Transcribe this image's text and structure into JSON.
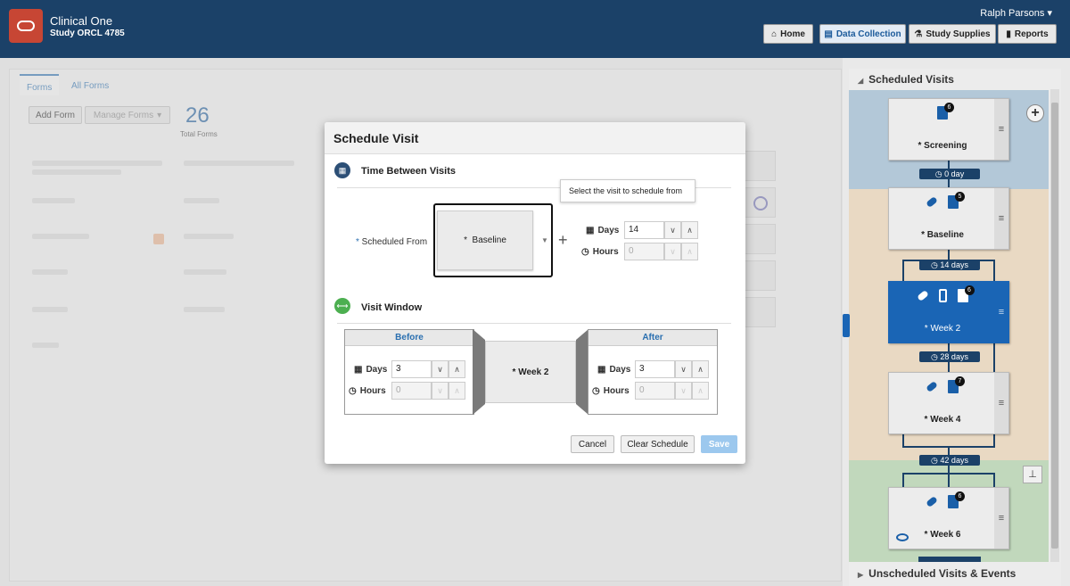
{
  "header": {
    "app_title": "Clinical One",
    "study": "Study ORCL 4785",
    "user": "Ralph Parsons",
    "nav": [
      {
        "label": "Home",
        "icon": "home-icon"
      },
      {
        "label": "Data Collection",
        "icon": "document-icon"
      },
      {
        "label": "Study Supplies",
        "icon": "supplies-icon"
      },
      {
        "label": "Reports",
        "icon": "bar-chart-icon"
      }
    ]
  },
  "forms": {
    "tabs": [
      "Forms",
      "All Forms"
    ],
    "add_form": "Add Form",
    "manage_forms": "Manage Forms",
    "total": "26",
    "total_label": "Total Forms"
  },
  "modal": {
    "title": "Schedule Visit",
    "section1": "Time Between Visits",
    "tooltip": "Select the visit to schedule from",
    "scheduled_from_label": "Scheduled From",
    "scheduled_from_value": "Baseline",
    "days_label": "Days",
    "hours_label": "Hours",
    "days_value": "14",
    "hours_value": "0",
    "section2": "Visit Window",
    "before": "Before",
    "after": "After",
    "before_days": "3",
    "before_hours": "0",
    "after_days": "3",
    "after_hours": "0",
    "visit_name": "Week 2",
    "cancel": "Cancel",
    "clear": "Clear Schedule",
    "save": "Save"
  },
  "side": {
    "title": "Scheduled Visits",
    "bottom": "Unscheduled Visits & Events",
    "visits": [
      {
        "name": "Screening",
        "badge": "6"
      },
      {
        "name": "Baseline",
        "badge": "5"
      },
      {
        "name": "Week 2",
        "badge": "6"
      },
      {
        "name": "Week 4",
        "badge": "7"
      },
      {
        "name": "Week 6",
        "badge": "6"
      }
    ],
    "gaps": [
      "0 day",
      "14 days",
      "28 days",
      "42 days"
    ]
  },
  "colors": {
    "header": "#1b4168",
    "accent": "#1a65b5",
    "brand": "#c74634"
  }
}
